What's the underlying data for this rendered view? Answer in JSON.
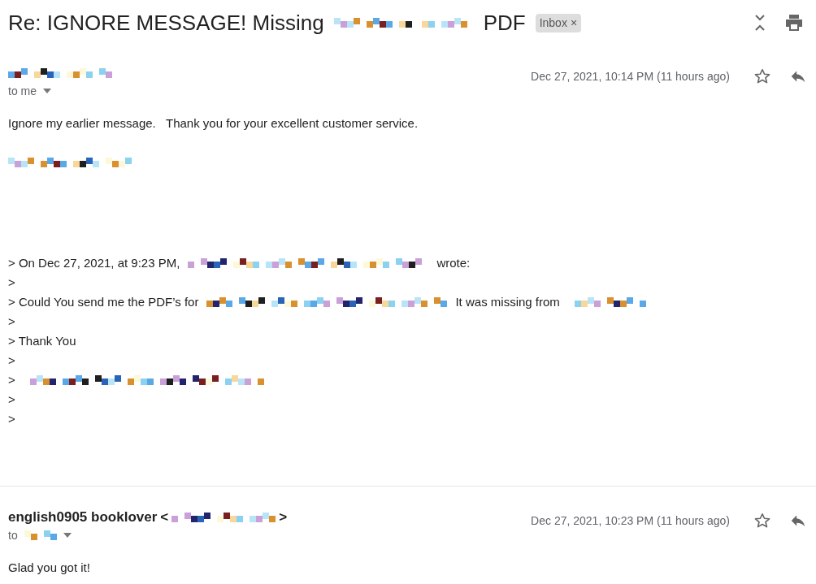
{
  "subject": {
    "segments": [
      {
        "kind": "text",
        "text": "Re: IGNORE MESSAGE! Missing"
      },
      {
        "kind": "redacted"
      },
      {
        "kind": "redacted"
      },
      {
        "kind": "text",
        "text": "PDF"
      }
    ],
    "label": "Inbox",
    "label_remove": "×"
  },
  "messages": [
    {
      "sender": [
        {
          "kind": "redacted"
        }
      ],
      "recipient": [
        {
          "kind": "text",
          "text": "to me"
        }
      ],
      "date": "Dec 27, 2021, 10:14 PM (11 hours ago)",
      "starred": false,
      "body": [
        {
          "kind": "line",
          "segments": [
            {
              "kind": "text",
              "text": "Ignore my earlier message.   Thank you for your excellent customer service."
            }
          ]
        },
        {
          "kind": "signature",
          "segments": [
            {
              "kind": "redacted"
            }
          ]
        },
        {
          "kind": "quote",
          "segments": [
            {
              "kind": "text",
              "text": "> On Dec 27, 2021, at 9:23 PM,"
            },
            {
              "kind": "redacted"
            },
            {
              "kind": "text",
              "text": "wrote:"
            }
          ]
        },
        {
          "kind": "quote",
          "segments": [
            {
              "kind": "text",
              "text": ">"
            }
          ]
        },
        {
          "kind": "quote",
          "segments": [
            {
              "kind": "text",
              "text": "> Could You send me the PDF’s for"
            },
            {
              "kind": "redacted"
            },
            {
              "kind": "text",
              "text": "It was missing from"
            },
            {
              "kind": "redacted"
            }
          ]
        },
        {
          "kind": "quote",
          "segments": [
            {
              "kind": "text",
              "text": ">"
            }
          ]
        },
        {
          "kind": "quote",
          "segments": [
            {
              "kind": "text",
              "text": "> Thank You"
            }
          ]
        },
        {
          "kind": "quote",
          "segments": [
            {
              "kind": "text",
              "text": ">"
            }
          ]
        },
        {
          "kind": "quote",
          "segments": [
            {
              "kind": "text",
              "text": ">"
            },
            {
              "kind": "redacted"
            }
          ]
        },
        {
          "kind": "quote",
          "segments": [
            {
              "kind": "text",
              "text": ">"
            }
          ]
        },
        {
          "kind": "quote",
          "segments": [
            {
              "kind": "text",
              "text": ">"
            }
          ]
        }
      ]
    },
    {
      "sender": [
        {
          "kind": "text",
          "text": "english0905 booklover"
        },
        {
          "kind": "text",
          "text": "<"
        },
        {
          "kind": "redacted"
        },
        {
          "kind": "text",
          "text": ">"
        }
      ],
      "recipient": [
        {
          "kind": "text",
          "text": "to"
        },
        {
          "kind": "redacted"
        }
      ],
      "date": "Dec 27, 2021, 10:23 PM (11 hours ago)",
      "starred": false,
      "body": [
        {
          "kind": "line",
          "segments": [
            {
              "kind": "text",
              "text": "Glad you got it!"
            }
          ]
        }
      ]
    }
  ]
}
